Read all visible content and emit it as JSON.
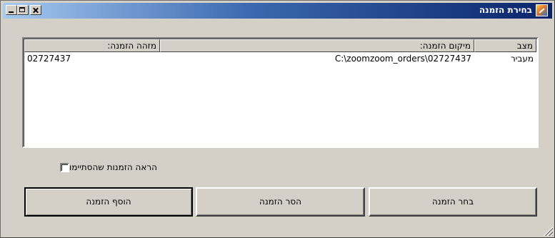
{
  "window": {
    "title": "בחירת הזמנה"
  },
  "list": {
    "columns": [
      "מצב",
      "מיקום הזמנה:",
      "מזהה הזמנה:"
    ],
    "rows": [
      {
        "status": "מעביר",
        "location": "C:\\zoomzoom_orders\\02727437",
        "id": "02727437"
      }
    ]
  },
  "checkbox": {
    "label": "הראה הזמנות שהסתיימו",
    "checked": false
  },
  "buttons": {
    "choose": "בחר הזמנה",
    "remove": "הסר הזמנה",
    "add": "הוסף הזמנה"
  },
  "icons": {
    "title": "app-icon",
    "minimize": "minimize-icon",
    "maximize": "maximize-icon",
    "close": "close-icon",
    "grip": "resize-grip-icon"
  }
}
